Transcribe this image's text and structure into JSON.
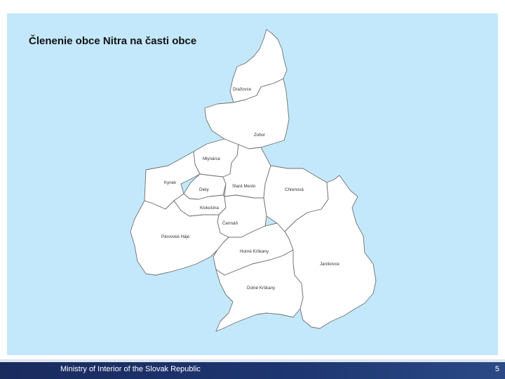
{
  "map": {
    "title": "Členenie obce Nitra na časti obce",
    "background_color": "#c3e8fb",
    "district_fill": "#ffffff",
    "districts": {
      "drazovce": "Dražovce",
      "zobor": "Zobor",
      "mlynarce": "Mlynárce",
      "kynek": "Kynek",
      "dolny": "Diely",
      "stare_mesto": "Staré Mesto",
      "chrenova": "Chrenová",
      "klokocina": "Klokočina",
      "cermán": "Čermáň",
      "parovske_haje": "Párovské Háje",
      "horne_krskany": "Horné Krškany",
      "janikovce": "Janíkovce",
      "dolne_krskany": "Dolné Krškany"
    }
  },
  "footer": {
    "text": "Ministry of Interior of the Slovak Republic",
    "page_number": "5",
    "color": "#1d3570"
  }
}
